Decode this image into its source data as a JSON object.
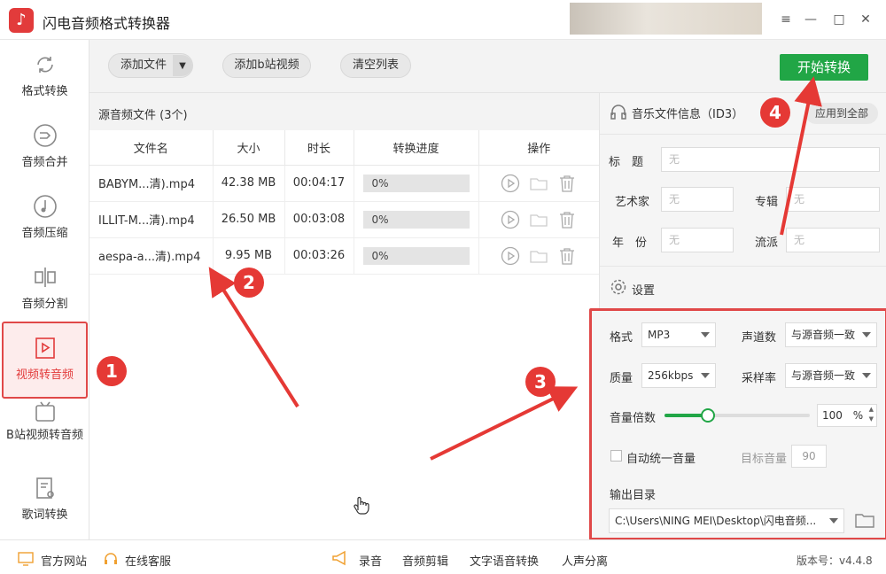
{
  "app": {
    "title": "闪电音频格式转换器"
  },
  "window_controls": [
    "≡",
    "—",
    "□",
    "✕"
  ],
  "sidebar": {
    "items": [
      {
        "label": "格式转换",
        "icon": "refresh-icon"
      },
      {
        "label": "音频合并",
        "icon": "merge-icon"
      },
      {
        "label": "音频压缩",
        "icon": "compress-icon"
      },
      {
        "label": "音频分割",
        "icon": "split-icon"
      },
      {
        "label": "视频转音频",
        "icon": "video-to-audio-icon",
        "active": true
      },
      {
        "label": "B站视频转音频",
        "icon": "bilibili-icon"
      },
      {
        "label": "歌词转换",
        "icon": "lyrics-icon"
      }
    ]
  },
  "toolbar": {
    "add_file": "添加文件",
    "add_bilibili": "添加b站视频",
    "clear_list": "清空列表",
    "start": "开始转换"
  },
  "files": {
    "header": "源音频文件 (3个)",
    "columns": [
      "文件名",
      "大小",
      "时长",
      "转换进度",
      "操作"
    ],
    "rows": [
      {
        "name": "BABYM...清).mp4",
        "size": "42.38 MB",
        "duration": "00:04:17",
        "progress": "0%"
      },
      {
        "name": "ILLIT-M...清).mp4",
        "size": "26.50 MB",
        "duration": "00:03:08",
        "progress": "0%"
      },
      {
        "name": "aespa-a...清).mp4",
        "size": "9.95 MB",
        "duration": "00:03:26",
        "progress": "0%"
      }
    ]
  },
  "music_info": {
    "title": "音乐文件信息（ID3）",
    "apply_all": "应用到全部",
    "fields": {
      "title_label": "标　题",
      "artist_label": "艺术家",
      "album_label": "专辑",
      "year_label": "年　份",
      "genre_label": "流派",
      "placeholder": "无"
    }
  },
  "settings": {
    "title": "设置",
    "format_label": "格式",
    "format_value": "MP3",
    "channels_label": "声道数",
    "channels_value": "与源音频一致",
    "quality_label": "质量",
    "quality_value": "256kbps",
    "samplerate_label": "采样率",
    "samplerate_value": "与源音频一致",
    "volume_label": "音量倍数",
    "volume_value": "100",
    "volume_unit": "%",
    "volume_fraction": 0.3,
    "auto_volume_label": "自动统一音量",
    "target_volume_label": "目标音量",
    "target_volume_value": "90",
    "output_label": "输出目录",
    "output_path": "C:\\Users\\NING MEI\\Desktop\\闪电音频..."
  },
  "statusbar": {
    "website": "官方网站",
    "support": "在线客服",
    "record": "录音",
    "edit": "音频剪辑",
    "tts": "文字语音转换",
    "vocal": "人声分离",
    "version": "版本号：v4.4.8"
  },
  "annotations": [
    "1",
    "2",
    "3",
    "4"
  ],
  "colors": {
    "accent": "#e23b3b",
    "start_button": "#21a646",
    "annotation": "#e53935"
  }
}
